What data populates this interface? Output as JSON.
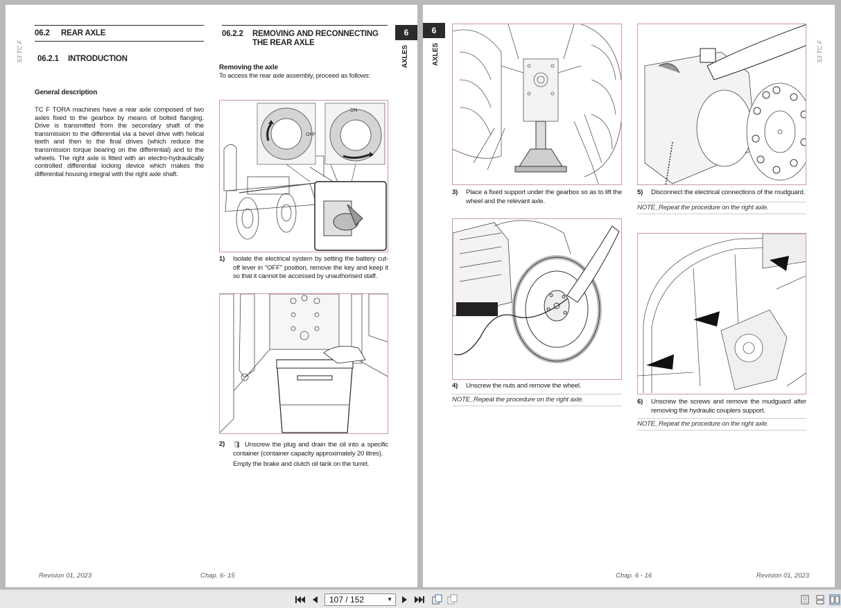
{
  "left_page": {
    "side_label": "53 TC F",
    "section": {
      "num": "06.2",
      "title": "REAR AXLE"
    },
    "subsection": {
      "num": "06.2.1",
      "title": "INTRODUCTION"
    },
    "general_title": "General description",
    "general_text": "TC F TORA machines have a rear axle composed of two axles fixed to the gearbox by means of bolted flanging. Drive is transmitted from the secondary shaft of the transmission to the differential via a bevel drive with helical teeth and then to the final drives (which reduce the transmission torque bearing on the differential) and to the wheels. The right axle is fitted with an electro-hydraulically controlled differential locking device which makes the differential housing integral with the right axle shaft.",
    "procedure_heading": {
      "num": "06.2.2",
      "title": "REMOVING AND RECONNECTING THE REAR AXLE"
    },
    "removing_title": "Removing the axle",
    "removing_intro": "To access the rear axle assembly, proceed as follows:",
    "fig1_labels": {
      "on": "ON",
      "off": "OFF"
    },
    "step1": {
      "n": "1)",
      "text": "Isolate the electrical system by setting the battery cut-off lever in \"OFF\" position, remove the key and keep it so that it cannot be accessed by unauthorised staff."
    },
    "step2": {
      "n": "2)",
      "text": "Unscrew the plug and drain the oil into a specific container (container capacity approximately 20 litres).",
      "text2": "Empty the brake and clutch oil tank on the turret."
    },
    "chapter_tab": "6",
    "chapter_label": "AXLES",
    "footer_left": "Revision 01, 2023",
    "footer_right": "Chap. 6- 15"
  },
  "right_page": {
    "side_label": "53 TC F",
    "chapter_tab": "6",
    "chapter_label": "AXLES",
    "step3": {
      "n": "3)",
      "text": "Place a fixed support under the gearbox so as to lift the wheel and the relevant axle."
    },
    "step4": {
      "n": "4)",
      "text": "Unscrew the nuts and remove the wheel."
    },
    "note4": "NOTE_Repeat the procedure on the right axle.",
    "step5": {
      "n": "5)",
      "text": "Disconnect the electrical connections of the mudguard."
    },
    "note5": "NOTE_Repeat the procedure on the right axle.",
    "step6": {
      "n": "6)",
      "text": "Unscrew the screws and remove the mudguard after removing the hydraulic couplers support."
    },
    "note6": "NOTE_Repeat the procedure on the right axle.",
    "footer_left": "Chap. 6 - 16",
    "footer_right": "Revision 01, 2023"
  },
  "toolbar": {
    "page_indicator": "107 / 152",
    "icons": [
      "first-page-icon",
      "prev-page-icon",
      "next-page-icon",
      "last-page-icon",
      "rotate-page-icon",
      "copy-page-icon",
      "single-page-view-icon",
      "continuous-view-icon",
      "facing-pages-view-icon"
    ]
  }
}
